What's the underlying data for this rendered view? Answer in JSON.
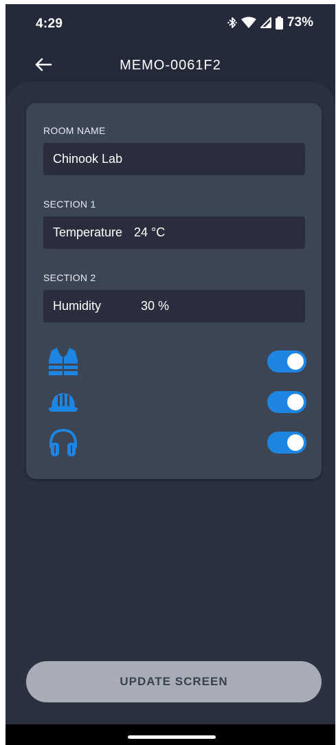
{
  "status_bar": {
    "time": "4:29",
    "battery": "73%",
    "icons": [
      "bluetooth-icon",
      "wifi-icon",
      "signal-icon",
      "battery-icon"
    ]
  },
  "header": {
    "title": "MEMO-0061F2",
    "back_icon": "arrow-left-icon"
  },
  "form": {
    "room_name_label": "ROOM NAME",
    "room_name_value": "Chinook Lab",
    "section1_label": "SECTION 1",
    "section1_name": "Temperature",
    "section1_value": "24 °C",
    "section2_label": "SECTION 2",
    "section2_name": "Humidity",
    "section2_value": "30 %"
  },
  "ppe": [
    {
      "icon": "safety-vest-icon",
      "enabled": true
    },
    {
      "icon": "hard-hat-icon",
      "enabled": true
    },
    {
      "icon": "ear-protection-icon",
      "enabled": true
    }
  ],
  "update_button_label": "UPDATE SCREEN",
  "colors": {
    "background": "#252a3a",
    "card": "#3c4554",
    "field": "#2a2d3c",
    "accent": "#1e86e2",
    "button": "#a7acb6"
  }
}
